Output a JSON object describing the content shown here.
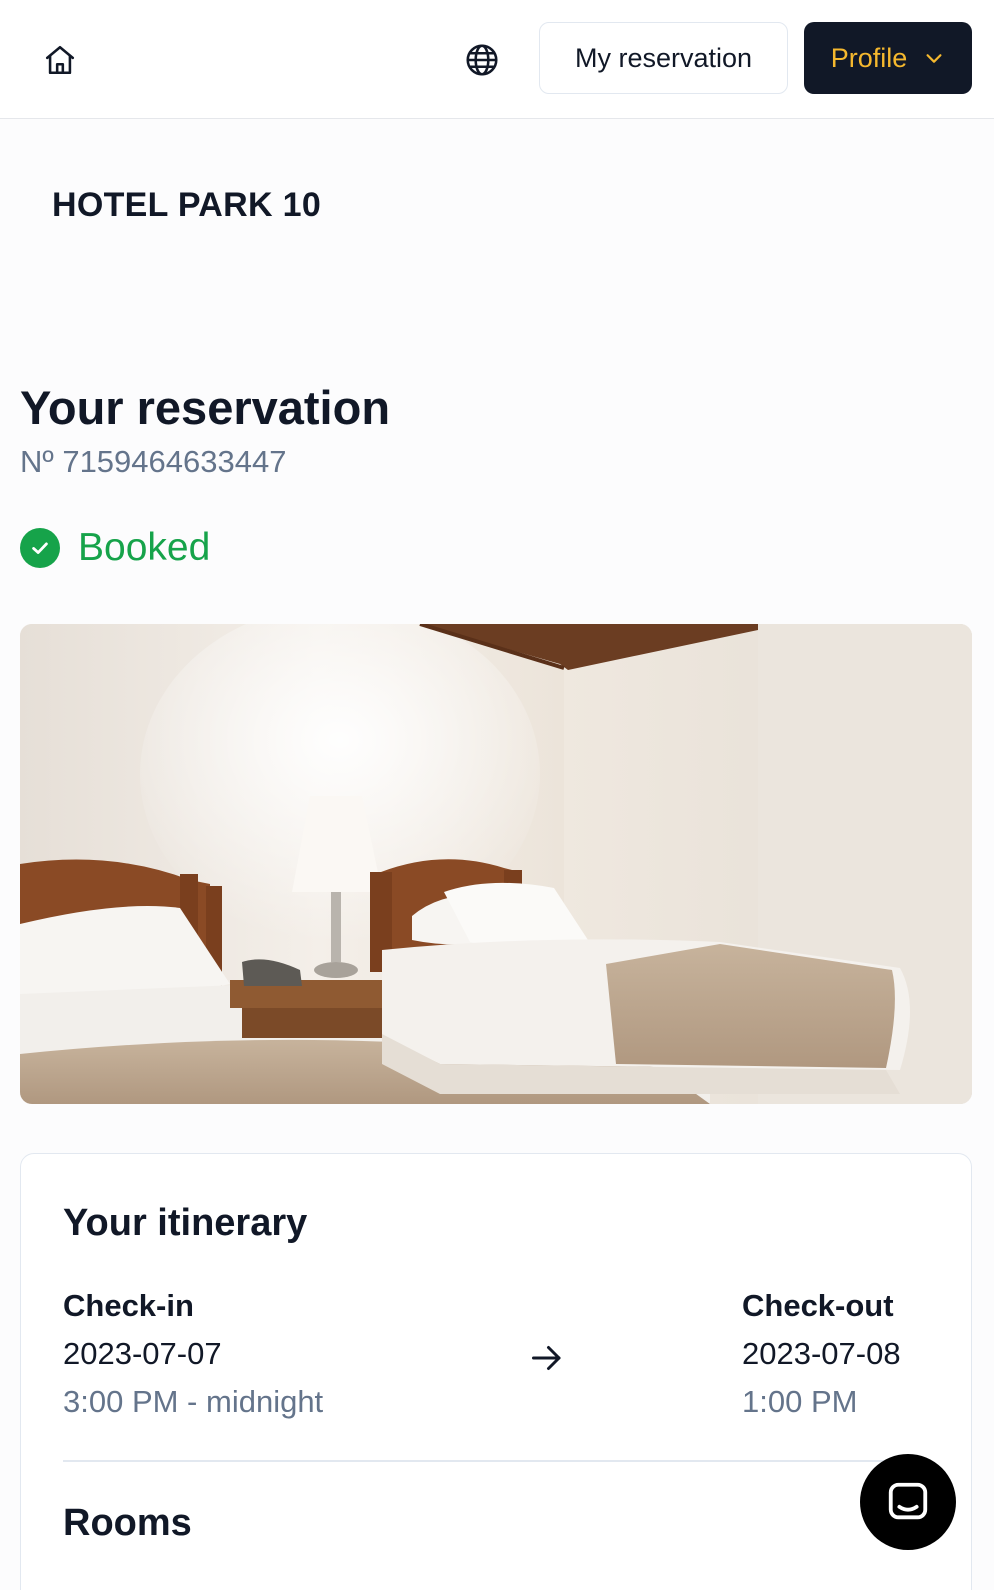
{
  "header": {
    "home_icon": "home-icon",
    "language_icon": "globe-icon",
    "my_reservation_label": "My reservation",
    "profile_label": "Profile",
    "profile_chevron_icon": "chevron-down-icon"
  },
  "hotel": {
    "name": "HOTEL PARK 10"
  },
  "reservation": {
    "title": "Your reservation",
    "number": "Nº 7159464633447",
    "status": "Booked",
    "status_icon": "check-circle-icon",
    "status_color": "#16a34a"
  },
  "itinerary": {
    "title": "Your itinerary",
    "check_in": {
      "label": "Check-in",
      "date": "2023-07-07",
      "time": "3:00 PM - midnight"
    },
    "arrow_icon": "arrow-right-icon",
    "check_out": {
      "label": "Check-out",
      "date": "2023-07-08",
      "time": "1:00 PM"
    },
    "rooms_title": "Rooms"
  },
  "chat": {
    "icon": "chat-icon"
  },
  "colors": {
    "primary_dark": "#111827",
    "accent": "#f5b82e",
    "muted": "#64748b",
    "success": "#16a34a"
  }
}
